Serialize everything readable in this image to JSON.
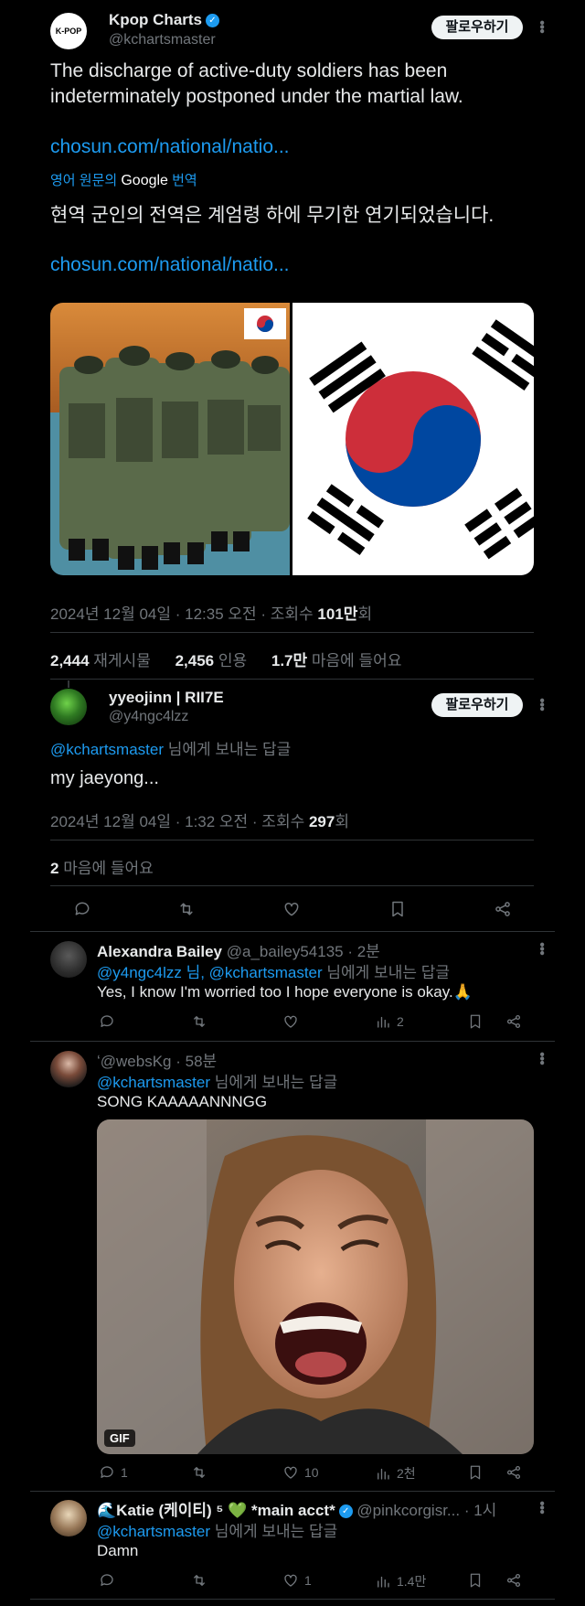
{
  "colors": {
    "accent": "#1d9bf0",
    "muted": "#71767b",
    "background": "#000000",
    "korea_red": "#cd2e3a",
    "korea_blue": "#0047a0"
  },
  "main_tweet": {
    "author_name": "Kpop Charts",
    "author_handle": "@kchartsmaster",
    "avatar_text": "K-POP",
    "follow_label": "팔로우하기",
    "text": "The discharge of active-duty soldiers has been indeterminately postponed under the martial law.",
    "link": "chosun.com/national/natio...",
    "translation_prefix": "영어 원문의",
    "translation_brand": "Google",
    "translation_suffix": "번역",
    "translated_text": "현역 군인의 전역은 계엄령 하에 무기한 연기되었습니다.",
    "link2": "chosun.com/national/natio...",
    "timestamp": "2024년 12월 04일 · 12:35 오전 · 조회수",
    "views": "101만",
    "views_suffix": "회",
    "retweets_count": "2,444",
    "retweets_label": "재게시물",
    "quotes_count": "2,456",
    "quotes_label": "인용",
    "likes_count": "1.7만",
    "likes_label": "마음에 들어요"
  },
  "focused_reply": {
    "author_name": "yyeojinn | RII7E",
    "author_handle": "@y4ngc4lzz",
    "follow_label": "팔로우하기",
    "reply_to_handle": "@kchartsmaster",
    "reply_to_suffix": "님에게 보내는 답글",
    "text": "my jaeyong...",
    "timestamp": "2024년 12월 04일 · 1:32 오전 · 조회수",
    "views": "297",
    "views_suffix": "회",
    "likes_count": "2",
    "likes_label": "마음에 들어요"
  },
  "replies": [
    {
      "author_name": "Alexandra Bailey",
      "author_handle": "@a_bailey54135",
      "time": "· 2분",
      "reply_to_handle": "@y4ngc4lzz 님, @kchartsmaster",
      "reply_to_suffix": "님에게 보내는 답글",
      "text": "Yes, I know I'm worried too I hope everyone is okay.🙏",
      "views": "2"
    },
    {
      "author_handle": "ʻ@websKg",
      "time": "· 58분",
      "reply_to_handle": "@kchartsmaster",
      "reply_to_suffix": "님에게 보내는 답글",
      "text": "SONG KAAAAANNNGG",
      "gif_badge": "GIF",
      "replies": "1",
      "likes": "10",
      "views": "2천"
    },
    {
      "author_name": "🌊Katie (케이티) ⁵ 💚 *main acct*",
      "author_handle": "@pinkcorgisr...",
      "time": "· 1시",
      "reply_to_handle": "@kchartsmaster",
      "reply_to_suffix": "님에게 보내는 답글",
      "text": "Damn",
      "likes": "1",
      "views": "1.4만"
    }
  ]
}
